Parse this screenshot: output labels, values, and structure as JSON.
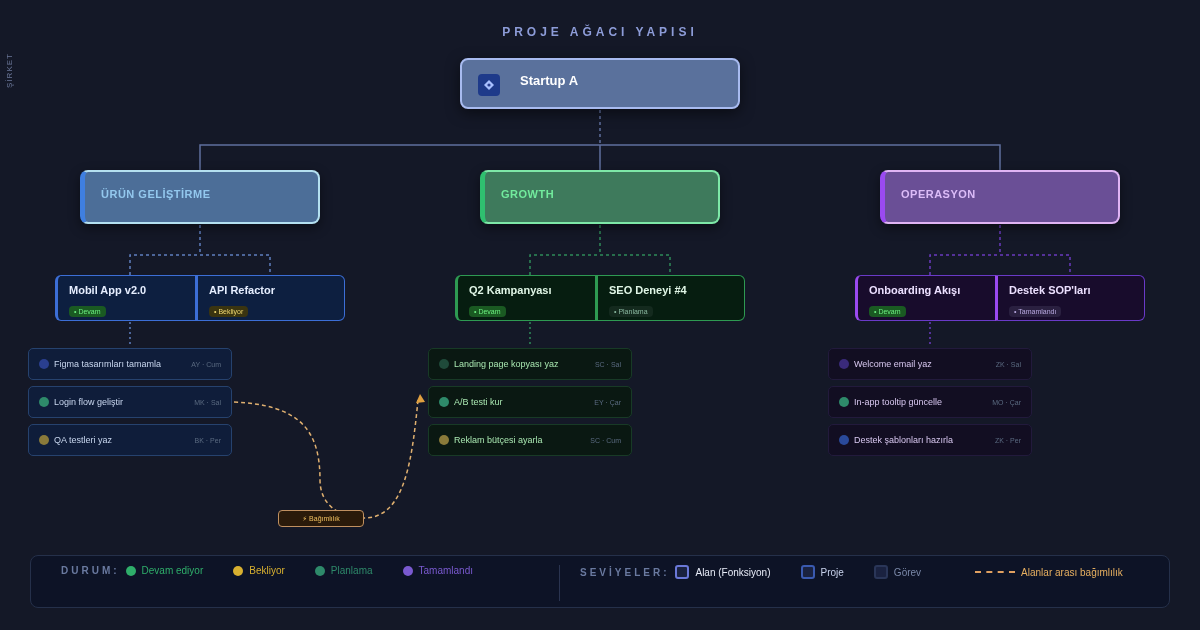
{
  "title": "PROJE AĞACI YAPISI",
  "side_label": "ŞİRKET",
  "root": {
    "name": "Startup A"
  },
  "areas": [
    {
      "name": "ÜRÜN GELİŞTİRME",
      "kind": "blue",
      "projects": [
        {
          "name": "Mobil App v2.0",
          "kind": "devam",
          "badge": "• Devam",
          "tasks": [
            {
              "name": "Figma tasarımları tamamla",
              "meta": "AY · Cum",
              "color": "#2a3f8f"
            },
            {
              "name": "Login flow geliştir",
              "meta": "MK · Sal",
              "color": "#2e8a6a"
            },
            {
              "name": "QA testleri yaz",
              "meta": "BK · Per",
              "color": "#8a7a3a"
            }
          ]
        },
        {
          "name": "API Refactor",
          "kind": "bekliyor",
          "badge": "• Bekliyor"
        }
      ]
    },
    {
      "name": "GROWTH",
      "kind": "green",
      "projects": [
        {
          "name": "Q2 Kampanyası",
          "kind": "devam",
          "badge": "• Devam",
          "tasks": [
            {
              "name": "Landing page kopyası yaz",
              "meta": "SC · Sal",
              "color": "#1f4a3a"
            },
            {
              "name": "A/B testi kur",
              "meta": "EY · Çar",
              "color": "#2e8a6a"
            },
            {
              "name": "Reklam bütçesi ayarla",
              "meta": "SC · Cum",
              "color": "#8a7a3a"
            }
          ]
        },
        {
          "name": "SEO Deneyi #4",
          "kind": "planlama",
          "badge": "• Planlama"
        }
      ]
    },
    {
      "name": "OPERASYON",
      "kind": "purple",
      "projects": [
        {
          "name": "Onboarding Akışı",
          "kind": "devam",
          "badge": "• Devam",
          "tasks": [
            {
              "name": "Welcome email yaz",
              "meta": "ZK · Sal",
              "color": "#3a2a7a"
            },
            {
              "name": "In-app tooltip güncelle",
              "meta": "MO · Çar",
              "color": "#2e8a6a"
            },
            {
              "name": "Destek şablonları hazırla",
              "meta": "ZK · Per",
              "color": "#2a4a9a"
            }
          ]
        },
        {
          "name": "Destek SOP'ları",
          "kind": "tamamlandi",
          "badge": "• Tamamlandı"
        }
      ]
    }
  ],
  "dependency": {
    "label": "⚡ Bağımlılık"
  },
  "legend": {
    "status_title": "DURUM:",
    "statuses": [
      {
        "label": "Devam ediyor",
        "color": "#2fae6a"
      },
      {
        "label": "Bekliyor",
        "color": "#d8b030"
      },
      {
        "label": "Planlama",
        "color": "#2e8a6a"
      },
      {
        "label": "Tamamlandı",
        "color": "#7a5ad0"
      }
    ],
    "levels_title": "SEVİYELER:",
    "levels": [
      {
        "label": "Alan (Fonksiyon)",
        "color": "#6a78d8"
      },
      {
        "label": "Proje",
        "color": "#3a5ab0"
      },
      {
        "label": "Görev",
        "color": "#2a3658"
      }
    ],
    "dependency_label": "Alanlar arası bağımlılık"
  }
}
